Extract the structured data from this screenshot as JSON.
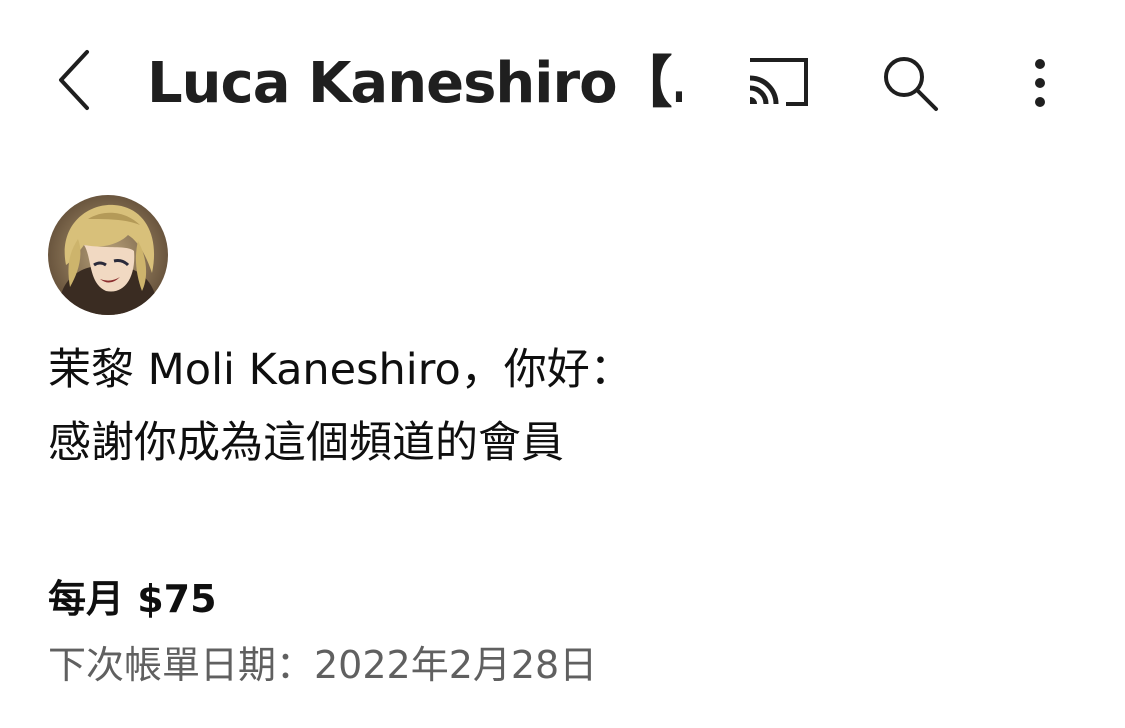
{
  "app_bar": {
    "title": "Luca Kaneshiro【…",
    "back_icon": "chevron-left-icon",
    "cast_icon": "cast-icon",
    "search_icon": "search-icon",
    "more_icon": "more-vert-icon"
  },
  "membership": {
    "avatar_icon": "channel-avatar",
    "greeting": "茉黎 Moli Kaneshiro，你好：",
    "thanks": "感謝你成為這個頻道的會員",
    "price": "每月 $75",
    "next_billing": "下次帳單日期：2022年2月28日"
  },
  "colors": {
    "text_primary": "#0f0f0f",
    "text_secondary": "#606060",
    "icon": "#1f1f1f",
    "background": "#ffffff"
  }
}
